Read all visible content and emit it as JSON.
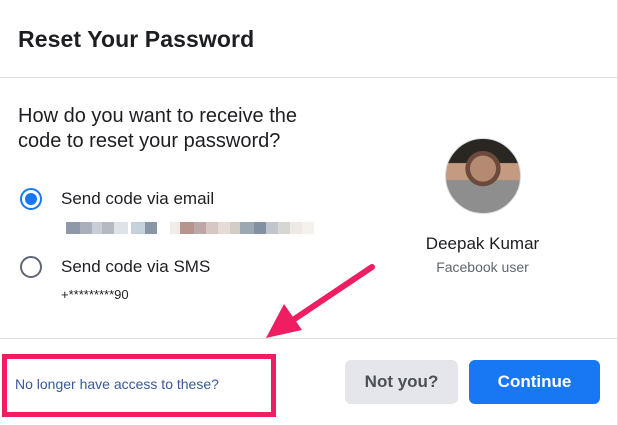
{
  "dialog": {
    "title": "Reset Your Password",
    "question": "How do you want to receive the code to reset your password?",
    "options": [
      {
        "label": "Send code via email",
        "selected": true,
        "detail": ""
      },
      {
        "label": "Send code via SMS",
        "selected": false,
        "detail": "+*********90"
      }
    ],
    "profile": {
      "name": "Deepak Kumar",
      "subtitle": "Facebook user"
    },
    "footer": {
      "no_access_link": "No longer have access to these?",
      "not_you_button": "Not you?",
      "continue_button": "Continue"
    }
  },
  "colors": {
    "primary": "#1877f2",
    "annotation": "#ef1d61",
    "link": "#385898"
  }
}
